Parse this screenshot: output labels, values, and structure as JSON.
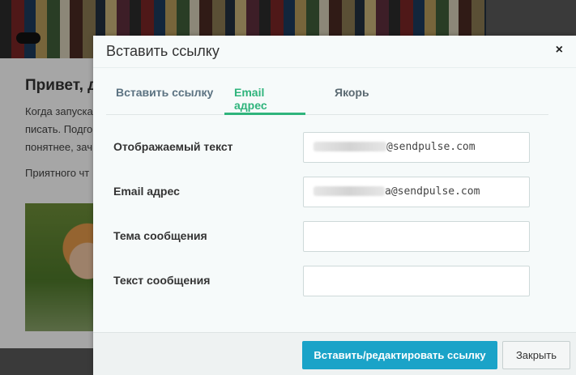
{
  "background": {
    "greeting": "Привет, д",
    "lines": [
      "Когда запуска",
      "писать. Подго",
      "понятнее, зач",
      "Приятного чт"
    ]
  },
  "modal": {
    "title": "Вставить ссылку",
    "close_symbol": "×",
    "tabs": [
      {
        "label": "Вставить ссылку",
        "active": false
      },
      {
        "label": "Email адрес",
        "active": true
      },
      {
        "label": "Якорь",
        "active": false
      }
    ],
    "fields": [
      {
        "label": "Отображаемый текст",
        "value": "@sendpulse.com"
      },
      {
        "label": "Email адрес",
        "value": "a@sendpulse.com"
      },
      {
        "label": "Тема сообщения",
        "value": ""
      },
      {
        "label": "Текст сообщения",
        "value": ""
      }
    ],
    "buttons": {
      "insert": "Вставить/редактировать ссылку",
      "close": "Закрыть"
    }
  },
  "colors": {
    "accent_green": "#2fb47c",
    "primary_blue": "#1aa3c8"
  },
  "icons": {
    "close": "close-icon"
  }
}
